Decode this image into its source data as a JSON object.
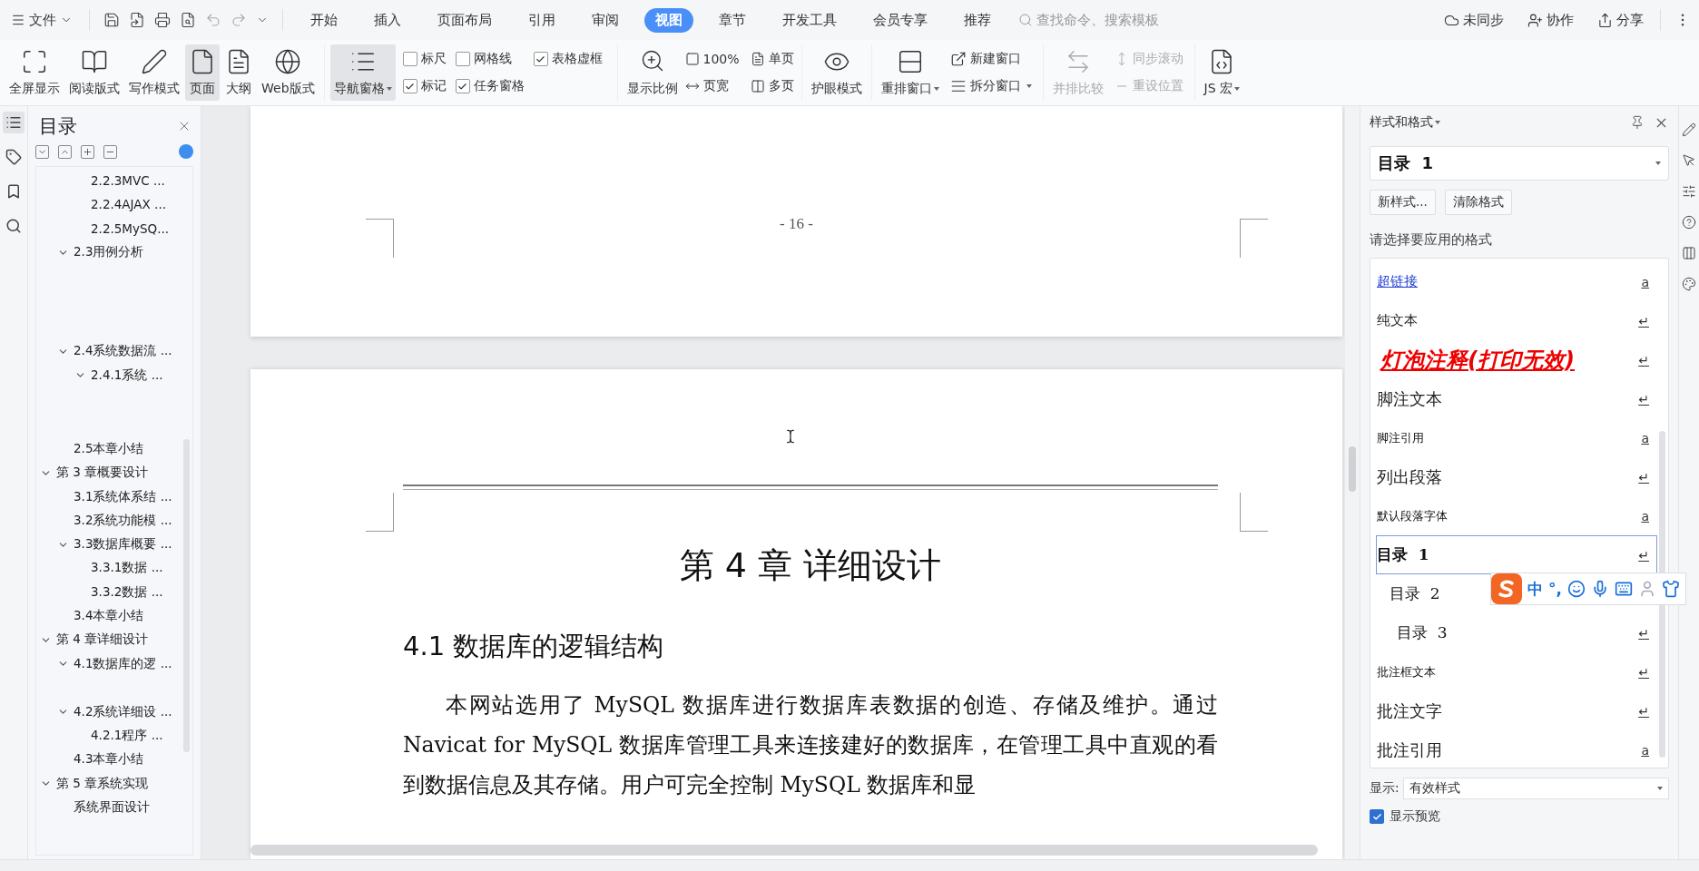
{
  "menu_bar": {
    "file_menu": "文件",
    "tabs": [
      {
        "label": "开始",
        "selected": false
      },
      {
        "label": "插入",
        "selected": false
      },
      {
        "label": "页面布局",
        "selected": false
      },
      {
        "label": "引用",
        "selected": false
      },
      {
        "label": "审阅",
        "selected": false
      },
      {
        "label": "视图",
        "selected": true
      },
      {
        "label": "章节",
        "selected": false
      },
      {
        "label": "开发工具",
        "selected": false
      },
      {
        "label": "会员专享",
        "selected": false
      },
      {
        "label": "推荐",
        "selected": false
      }
    ],
    "search": {
      "placeholder": "查找命令、搜索模板"
    },
    "actions": [
      "未同步",
      "协作",
      "分享"
    ]
  },
  "ribbon": {
    "view_buttons": [
      {
        "label": "全屏显示",
        "selected": false
      },
      {
        "label": "阅读版式",
        "selected": false
      },
      {
        "label": "写作模式",
        "selected": false
      },
      {
        "label": "页面",
        "selected": true
      },
      {
        "label": "大纲",
        "selected": false
      },
      {
        "label": "Web版式",
        "selected": false
      }
    ],
    "nav_pane": {
      "label": "导航窗格",
      "selected": true,
      "dropdown": true
    },
    "checkboxes": [
      {
        "label": "标尺",
        "checked": false
      },
      {
        "label": "网格线",
        "checked": false
      },
      {
        "label": "表格虚框",
        "checked": true
      },
      {
        "label": "标记",
        "checked": true
      },
      {
        "label": "任务窗格",
        "checked": true
      }
    ],
    "zoom_button": {
      "label": "显示比例"
    },
    "zoom_options": [
      {
        "label": "100%"
      },
      {
        "label": "单页"
      },
      {
        "label": "页宽"
      },
      {
        "label": "多页"
      }
    ],
    "eye_mode": {
      "label": "护眼模式"
    },
    "arrange": {
      "label": "重排窗口",
      "dropdown": true
    },
    "window_options": [
      {
        "label": "新建窗口",
        "dropdown": false
      },
      {
        "label": "拆分窗口",
        "dropdown": true
      }
    ],
    "compare": {
      "label": "并排比较",
      "disabled": true
    },
    "sync_options": [
      {
        "label": "同步滚动",
        "disabled": true
      },
      {
        "label": "重设位置",
        "disabled": true
      }
    ],
    "macro": {
      "label": "JS 宏",
      "dropdown": true
    }
  },
  "navigation": {
    "title": "目录",
    "continued_subitems": [
      {
        "label": "2.2.3MVC ..."
      },
      {
        "label": "2.2.4AJAX ..."
      },
      {
        "label": "2.2.5MySQ..."
      }
    ],
    "continued_items": [
      {
        "label": "2.3用例分析",
        "expanded": true
      },
      {
        "label": "2.4系统数据流 ...",
        "expanded": true,
        "children": [
          {
            "label": "2.4.1系统 ...",
            "expanded": true
          }
        ]
      },
      {
        "label": "2.5本章小结"
      }
    ],
    "items": [
      {
        "label": "第 3 章概要设计",
        "expanded": true,
        "children": [
          {
            "label": "3.1系统体系结 ..."
          },
          {
            "label": "3.2系统功能模 ..."
          },
          {
            "label": "3.3数据库概要 ...",
            "expanded": true,
            "children": [
              {
                "label": "3.3.1数据 ..."
              },
              {
                "label": "3.3.2数据 ..."
              }
            ]
          },
          {
            "label": "3.4本章小结"
          }
        ]
      },
      {
        "label": "第 4 章详细设计",
        "expanded": true,
        "children": [
          {
            "label": "4.1数据库的逻 ...",
            "expanded": true
          },
          {
            "label": "4.2系统详细设 ...",
            "expanded": true,
            "children": [
              {
                "label": "4.2.1程序 ..."
              }
            ]
          },
          {
            "label": "4.3本章小结"
          }
        ]
      },
      {
        "label": "第 5 章系统实现",
        "expanded": true,
        "children": [
          {
            "label": "系统界面设计"
          }
        ]
      }
    ]
  },
  "document": {
    "previous_page": {
      "page_number": "- 16 -"
    },
    "current_page": {
      "chapter_title": "第 4 章  详细设计",
      "section_heading": "4.1  数据库的逻辑结构",
      "paragraph": "本网站选用了 MySQL 数据库进行数据库表数据的创造、存储及维护。通过 Navicat for MySQL 数据库管理工具来连接建好的数据库，在管理工具中直观的看到数据信息及其存储。用户可完全控制 MySQL 数据库和显"
    }
  },
  "styles_panel": {
    "title": "样式和格式",
    "current_style": "目录  1",
    "buttons": [
      "新样式...",
      "清除格式"
    ],
    "prompt": "请选择要应用的格式",
    "styles": [
      {
        "label": "超链接",
        "kind": "link",
        "mark": "a",
        "selected": false
      },
      {
        "label": "纯文本",
        "kind": "plain",
        "mark": "↵",
        "selected": false
      },
      {
        "label": "灯泡注释(打印无效)",
        "kind": "bulb",
        "mark": "↵",
        "selected": false
      },
      {
        "label": "脚注文本",
        "kind": "serif",
        "mark": "↵",
        "selected": false
      },
      {
        "label": "脚注引用",
        "kind": "small",
        "mark": "a",
        "selected": false
      },
      {
        "label": "列出段落",
        "kind": "serif",
        "mark": "↵",
        "selected": false
      },
      {
        "label": "默认段落字体",
        "kind": "small",
        "mark": "a",
        "selected": false
      },
      {
        "label": "目录  1",
        "kind": "toc1",
        "mark": "↵",
        "selected": true
      },
      {
        "label": "目录  2",
        "kind": "toc2",
        "selected": false
      },
      {
        "label": "目录  3",
        "kind": "toc3",
        "mark": "↵",
        "selected": false
      },
      {
        "label": "批注框文本",
        "kind": "small",
        "mark": "↵",
        "selected": false
      },
      {
        "label": "批注文字",
        "kind": "serif",
        "mark": "↵",
        "selected": false
      },
      {
        "label": "批注引用",
        "kind": "serif",
        "mark": "a",
        "selected": false
      }
    ],
    "show_label": "显示:",
    "show_value": "有效样式",
    "preview": {
      "label": "显示预览",
      "checked": true
    }
  },
  "ime_toolbar": {
    "mode": "中",
    "punctuation": "°,"
  }
}
